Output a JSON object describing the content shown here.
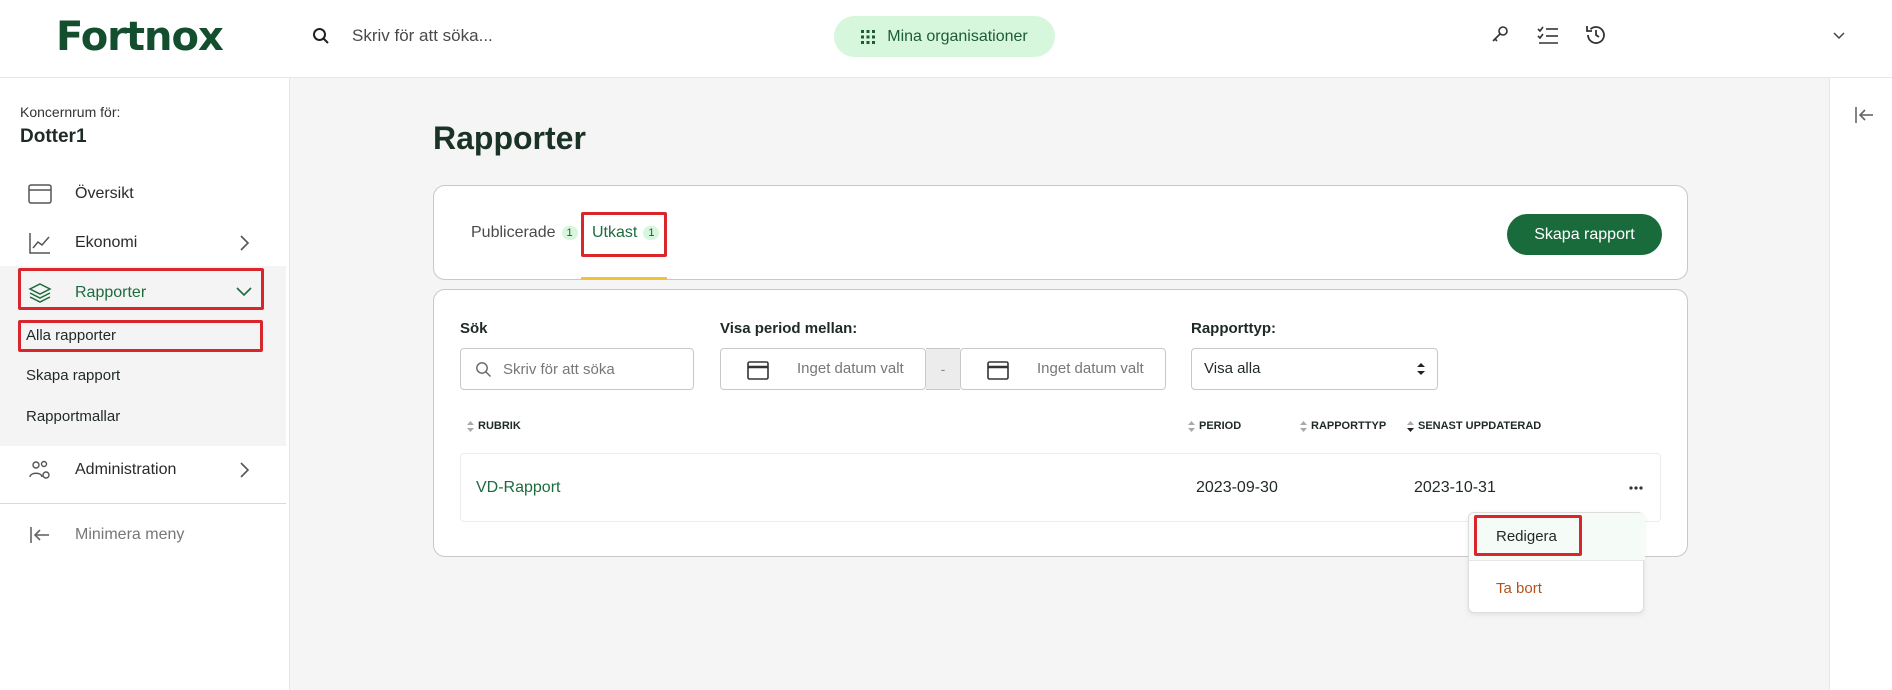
{
  "header": {
    "logo": "Fortnox",
    "search_placeholder": "Skriv för att söka...",
    "org_button": "Mina organisationer"
  },
  "sidebar": {
    "org_for_label": "Koncernrum för:",
    "org_name": "Dotter1",
    "items": [
      {
        "label": "Översikt"
      },
      {
        "label": "Ekonomi"
      },
      {
        "label": "Rapporter"
      },
      {
        "label": "Administration"
      }
    ],
    "sub_items": [
      {
        "label": "Alla rapporter"
      },
      {
        "label": "Skapa rapport"
      },
      {
        "label": "Rapportmallar"
      }
    ],
    "minimize_label": "Minimera meny"
  },
  "main": {
    "title": "Rapporter",
    "tabs": [
      {
        "label": "Publicerade",
        "count": "1"
      },
      {
        "label": "Utkast",
        "count": "1"
      }
    ],
    "create_button": "Skapa rapport",
    "filters": {
      "search_label": "Sök",
      "search_placeholder": "Skriv för att söka",
      "period_label": "Visa period mellan:",
      "date_placeholder": "Inget datum valt",
      "dash": "-",
      "type_label": "Rapporttyp:",
      "type_value": "Visa alla"
    },
    "columns": [
      "RUBRIK",
      "PERIOD",
      "RAPPORTTYP",
      "SENAST UPPDATERAD"
    ],
    "rows": [
      {
        "title": "VD-Rapport",
        "period": "2023-09-30",
        "type": "",
        "updated": "2023-10-31"
      }
    ],
    "row_menu": {
      "edit": "Redigera",
      "delete": "Ta bort"
    }
  },
  "colors": {
    "brand": "#134f2f",
    "accent_green": "#1a6b3c",
    "tab_indicator": "#f0c23a",
    "highlight_red": "#d9262c",
    "danger": "#b3531c"
  }
}
